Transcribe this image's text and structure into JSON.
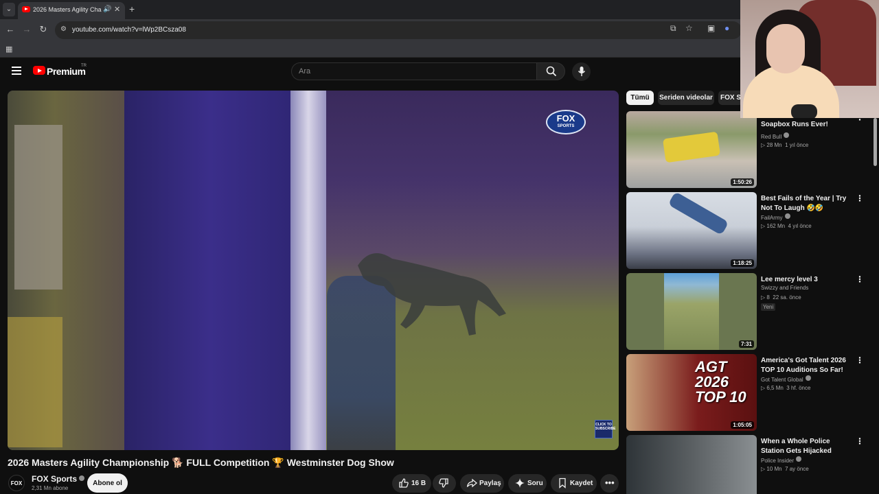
{
  "browser": {
    "tab_title": "2026 Masters Agility Championship 🐕 FULL Competition 🏆 Westminster Dog Show",
    "url": "youtube.com/watch?v=lWp2BCsza08"
  },
  "header": {
    "brand": "Premium",
    "region": "TR",
    "search_placeholder": "Ara"
  },
  "video": {
    "overlay_brand": "FOX",
    "overlay_brand_sub": "SPORTS",
    "subscribe_overlay": "CLICK TO SUBSCRIBE",
    "title": "2026 Masters Agility Championship 🐕 FULL Competition 🏆 Westminster Dog Show"
  },
  "channel": {
    "avatar_text": "FOX",
    "name": "FOX Sports",
    "subscribers": "2,31 Mn abone",
    "subscribe_label": "Abone ol"
  },
  "actions": {
    "likes": "16 B",
    "share": "Paylaş",
    "ask": "Soru",
    "save": "Kaydet"
  },
  "chips": [
    "Tümü",
    "Seriden videolar",
    "FOX S"
  ],
  "recommendations": [
    {
      "title": "Soapbox Runs Ever!",
      "channel": "Red Bull",
      "views": "28 Mn",
      "age": "1 yıl önce",
      "duration": "1:50:26",
      "colors": [
        "#8a9a6a",
        "#c9c0b4"
      ]
    },
    {
      "title": "Best Fails of the Year | Try Not To Laugh 🤣🤣",
      "channel": "FailArmy",
      "views": "162 Mn",
      "age": "4 yıl önce",
      "duration": "1:18:25",
      "colors": [
        "#c9cfd8",
        "#6d7384"
      ]
    },
    {
      "title": "Lee mercy level 3",
      "channel": "Swizzy and Friends",
      "views": "8",
      "age": "22 sa. önce",
      "badge": "Yeni",
      "duration": "7:31",
      "colors": [
        "#6a7650",
        "#9aa468"
      ]
    },
    {
      "title": "America's Got Talent 2026 TOP 10 Auditions So Far!",
      "channel": "Got Talent Global",
      "views": "6,5 Mn",
      "age": "3 hf. önce",
      "duration": "1:05:05",
      "thumb_text": "AGT 2026 TOP 10",
      "colors": [
        "#7a1c1c",
        "#c8a07a"
      ]
    },
    {
      "title": "When a Whole Police Station Gets Hijacked",
      "channel": "Police Insider",
      "views": "10 Mn",
      "age": "7 ay önce",
      "colors": [
        "#2e3438",
        "#8a8f92"
      ]
    }
  ]
}
